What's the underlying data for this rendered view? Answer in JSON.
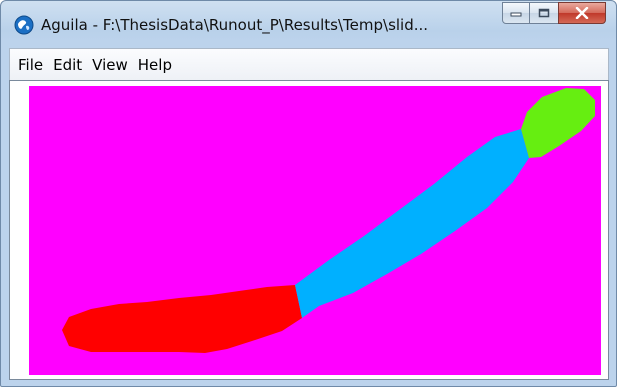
{
  "window": {
    "title": "Aguila - F:\\ThesisData\\Runout_P\\Results\\Temp\\slid...",
    "app_icon": "aguila-globe-icon",
    "buttons": {
      "minimize": "minimize-icon",
      "maximize": "maximize-icon",
      "close": "close-icon"
    }
  },
  "menu": {
    "items": [
      "File",
      "Edit",
      "View",
      "Help"
    ]
  },
  "map": {
    "background_color": "#ff00ff",
    "classes": [
      {
        "color": "#ff0000"
      },
      {
        "color": "#00b0ff"
      },
      {
        "color": "#66ee11"
      }
    ]
  }
}
